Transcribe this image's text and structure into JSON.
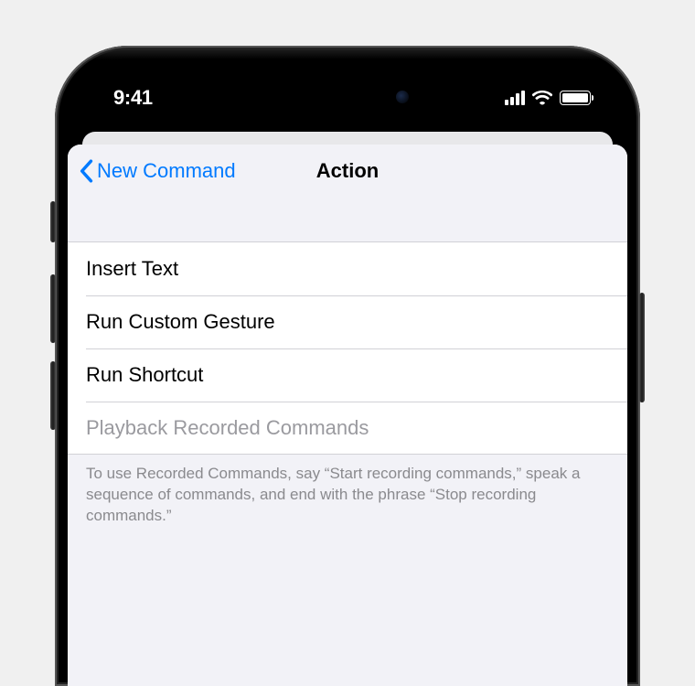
{
  "status": {
    "time": "9:41"
  },
  "nav": {
    "back_label": "New Command",
    "title": "Action"
  },
  "actions": [
    {
      "label": "Insert Text",
      "enabled": true
    },
    {
      "label": "Run Custom Gesture",
      "enabled": true
    },
    {
      "label": "Run Shortcut",
      "enabled": true
    },
    {
      "label": "Playback Recorded Commands",
      "enabled": false
    }
  ],
  "footer": "To use Recorded Commands, say “Start recording commands,” speak a sequence of commands, and end with the phrase “Stop recording commands.”"
}
